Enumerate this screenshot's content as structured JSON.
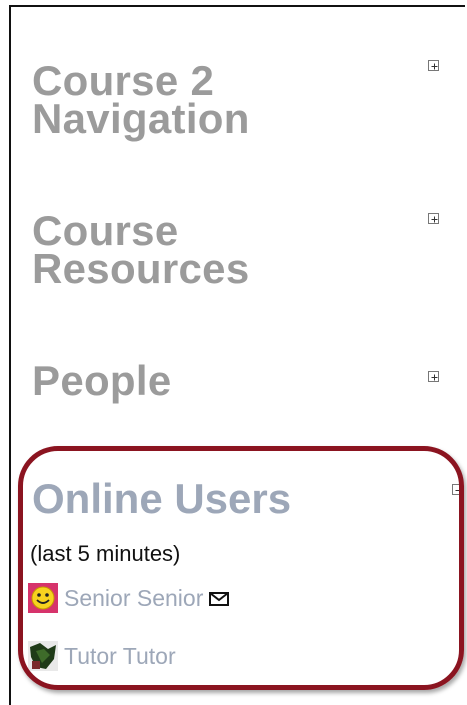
{
  "blocks": [
    {
      "title_line1": "Course 2",
      "title_line2": "Navigation",
      "toggle": "plus-icon"
    },
    {
      "title_line1": "Course",
      "title_line2": "Resources",
      "toggle": "plus-icon"
    },
    {
      "title_line1": "People",
      "toggle": "plus-icon"
    }
  ],
  "online_users": {
    "title": "Online Users",
    "subtitle": "(last 5 minutes)",
    "toggle": "minus-icon",
    "users": [
      {
        "name": "Senior Senior",
        "avatar": "smiley-avatar",
        "message_icon": "envelope-icon"
      },
      {
        "name": "Tutor Tutor",
        "avatar": "photo-avatar"
      }
    ]
  },
  "colors": {
    "block_title": "#9b9b9b",
    "online_title": "#9da7b8",
    "highlight": "#8b1420"
  }
}
